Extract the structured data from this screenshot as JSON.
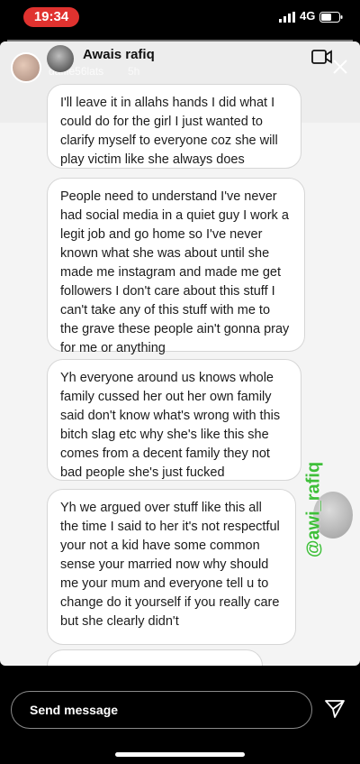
{
  "status_bar": {
    "time": "19:34",
    "network": "4G"
  },
  "story": {
    "username": "daffie56lats",
    "time_ago": "5h"
  },
  "dm": {
    "contact_name": "Awais rafiq",
    "messages": [
      "I'll leave it in allahs hands I did what I could do for the girl I just wanted to clarify myself to everyone coz she will play victim like she always does",
      "People need to understand I've never had social media in a quiet guy I work a legit job and go home so I've never known what she was about until she made me instagram and made me get followers I don't care about this stuff I can't take any of this stuff with me to the grave these people ain't gonna pray for me or anything",
      "Yh everyone around us knows whole family cussed her out her own family said don't know what's wrong with this bitch slag etc why she's like this she comes from a decent family they not bad people she's just fucked",
      "Yh we argued over stuff like this all the time I said to her it's not respectful your not a kid have some common sense your married now why should me your mum and everyone tell u to change do it yourself if you really care but she clearly didn't"
    ]
  },
  "watermark": "@awi_rafiq",
  "reply_bar": {
    "placeholder": "Send message"
  },
  "icons": {
    "close": "close-icon",
    "video": "video-camera-icon",
    "send": "paper-plane-icon"
  },
  "colors": {
    "time_pill": "#e0322f",
    "watermark": "#3fbf3a"
  }
}
